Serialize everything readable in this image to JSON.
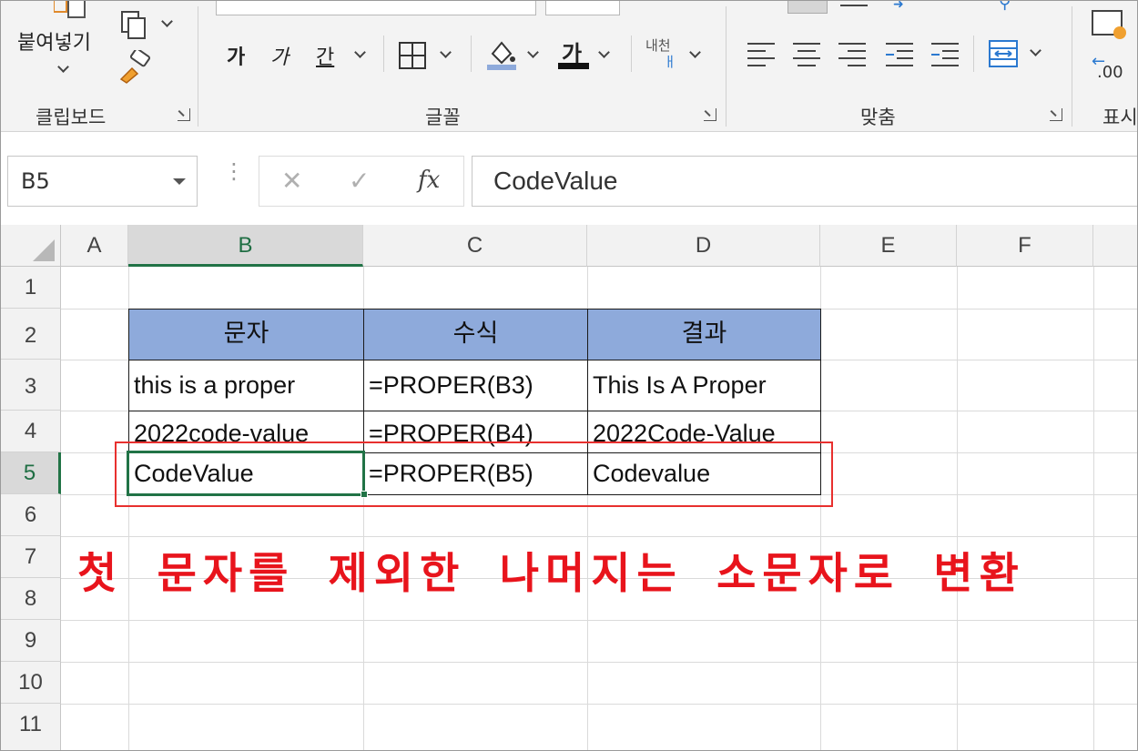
{
  "ribbon": {
    "clipboard": {
      "label": "클립보드",
      "paste_label": "붙여넣기"
    },
    "font": {
      "label": "글꼴",
      "bold_label": "가",
      "italic_label": "가",
      "underline_label": "간",
      "fontcolor_label": "가",
      "phonetic_label": "내천"
    },
    "alignment": {
      "label": "맞춤"
    },
    "number": {
      "label": "표시",
      "format_label": ".00"
    }
  },
  "formula_bar": {
    "name_box": "B5",
    "cancel_glyph": "✕",
    "enter_glyph": "✓",
    "fx_label": "fx",
    "formula": "CodeValue"
  },
  "sheet": {
    "columns": [
      "A",
      "B",
      "C",
      "D",
      "E",
      "F"
    ],
    "rows": [
      "1",
      "2",
      "3",
      "4",
      "5",
      "6",
      "7",
      "8",
      "9",
      "10",
      "11"
    ],
    "selected_cell": "B5"
  },
  "table": {
    "headers": [
      "문자",
      "수식",
      "결과"
    ],
    "rows": [
      [
        "this is a proper",
        "=PROPER(B3)",
        "This Is A Proper"
      ],
      [
        "2022code-value",
        "=PROPER(B4)",
        "2022Code-Value"
      ],
      [
        "CodeValue",
        "=PROPER(B5)",
        "Codevalue"
      ]
    ]
  },
  "annotation": {
    "text": "첫 문자를 제외한 나머지는 소문자로 변환",
    "color": "#e8141c"
  },
  "colors": {
    "header_fill": "#8eaadb",
    "excel_green": "#217346",
    "highlight_red": "#e8302e"
  }
}
